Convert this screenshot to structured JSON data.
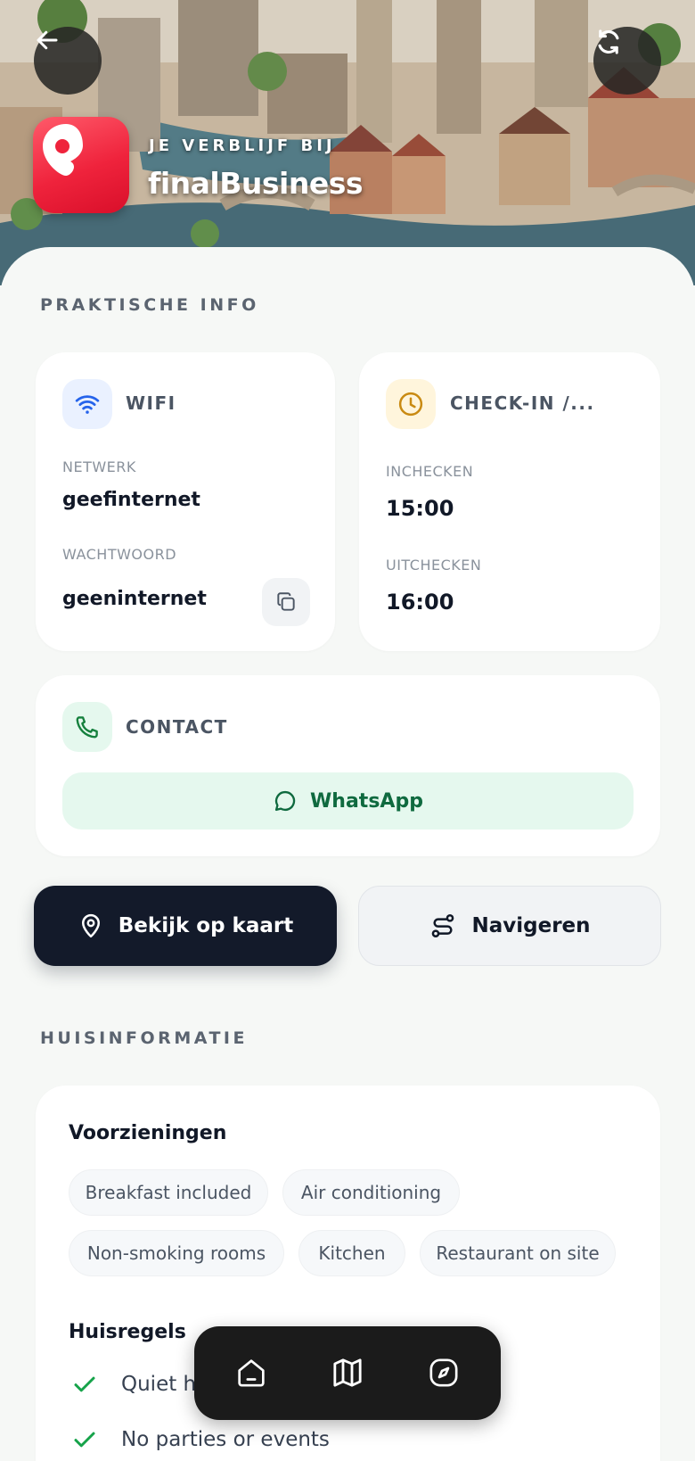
{
  "hero": {
    "stay_label": "JE VERBLIJF BIJ",
    "business_name": "finalBusiness",
    "back_icon": "arrow-left-icon",
    "refresh_icon": "refresh-icon",
    "logo_icon": "pin-logo-icon"
  },
  "practical": {
    "title": "PRAKTISCHE INFO",
    "wifi": {
      "heading": "WIFI",
      "network_label": "NETWERK",
      "network_value": "geefinternet",
      "password_label": "WACHTWOORD",
      "password_value": "geeninternet",
      "copy_icon": "copy-icon"
    },
    "checkin": {
      "heading": "CHECK-IN /...",
      "in_label": "INCHECKEN",
      "in_value": "15:00",
      "out_label": "UITCHECKEN",
      "out_value": "16:00"
    },
    "contact": {
      "heading": "CONTACT",
      "whatsapp_label": "WhatsApp"
    }
  },
  "actions": {
    "map_label": "Bekijk op kaart",
    "navigate_label": "Navigeren"
  },
  "house": {
    "title": "HUISINFORMATIE",
    "amenities_title": "Voorzieningen",
    "amenities": [
      "Breakfast included",
      "Air conditioning",
      "Non-smoking rooms",
      "Kitchen",
      "Restaurant on site"
    ],
    "rules_title": "Huisregels",
    "rules": [
      "Quiet hours",
      "No parties or events"
    ]
  },
  "tabbar": {
    "tabs": [
      "home-icon",
      "map-icon",
      "compass-icon"
    ]
  },
  "colors": {
    "dark": "#131a2a",
    "wifi_blue": "#2563eb",
    "clock_amber": "#c98a12",
    "whatsapp_green": "#0f6a3f",
    "check_green": "#16a34a"
  }
}
